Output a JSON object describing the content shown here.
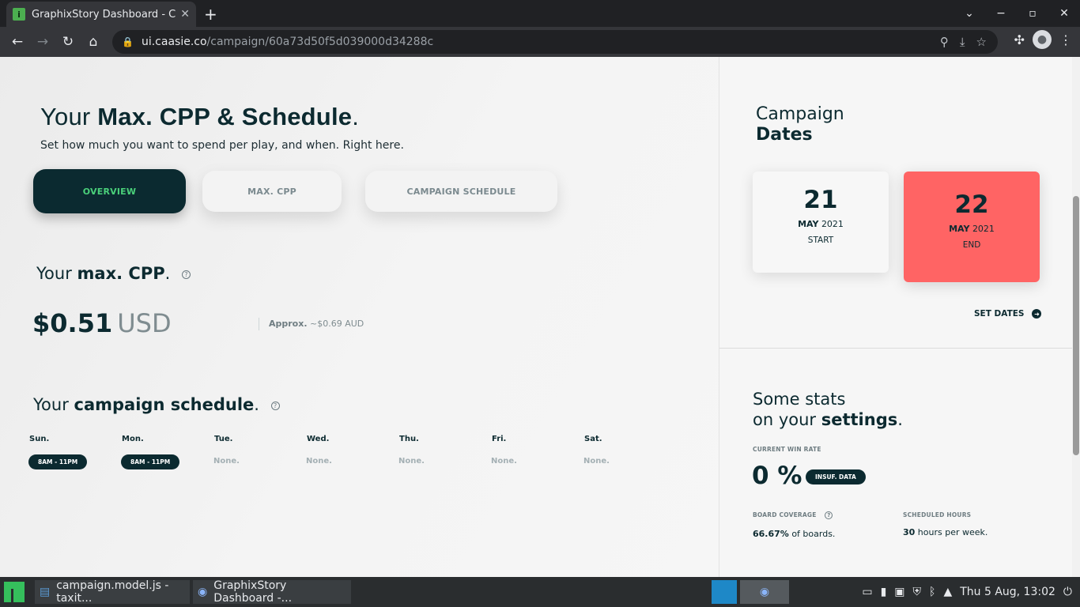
{
  "browser": {
    "tab_title": "GraphixStory Dashboard - CA",
    "url_host": "ui.caasie.co",
    "url_path": "/campaign/60a73d50f5d039000d34288c"
  },
  "header": {
    "title_prefix": "Your ",
    "title_bold": "Max. CPP & Schedule",
    "title_suffix": ".",
    "subtitle": "Set how much you want to spend per play, and when. Right here."
  },
  "tabs": {
    "overview": "OVERVIEW",
    "max_cpp": "MAX. CPP",
    "campaign_schedule": "CAMPAIGN SCHEDULE"
  },
  "cpp": {
    "heading_prefix": "Your ",
    "heading_bold": "max. CPP",
    "heading_suffix": ".",
    "amount": "$0.51",
    "currency": "USD",
    "approx_label": "Approx.",
    "approx_value": "~$0.69 AUD"
  },
  "schedule": {
    "heading_prefix": "Your ",
    "heading_bold": "campaign schedule",
    "heading_suffix": ".",
    "days": [
      {
        "name": "Sun.",
        "value": "8AM - 11PM"
      },
      {
        "name": "Mon.",
        "value": "8AM - 11PM"
      },
      {
        "name": "Tue.",
        "value": "None."
      },
      {
        "name": "Wed.",
        "value": "None."
      },
      {
        "name": "Thu.",
        "value": "None."
      },
      {
        "name": "Fri.",
        "value": "None."
      },
      {
        "name": "Sat.",
        "value": "None."
      }
    ]
  },
  "dates": {
    "title_line1": "Campaign",
    "title_line2": "Dates",
    "start": {
      "day": "21",
      "month": "MAY",
      "year": "2021",
      "label": "START"
    },
    "end": {
      "day": "22",
      "month": "MAY",
      "year": "2021",
      "label": "END"
    },
    "set_dates": "SET DATES"
  },
  "stats": {
    "title_line1": "Some stats",
    "title_line2_prefix": "on your ",
    "title_line2_bold": "settings",
    "title_line2_suffix": ".",
    "win_rate_label": "CURRENT WIN RATE",
    "win_rate": "0 %",
    "win_rate_badge": "INSUF. DATA",
    "coverage_label": "BOARD COVERAGE",
    "coverage_value": "66.67%",
    "coverage_suffix": " of boards.",
    "hours_label": "SCHEDULED HOURS",
    "hours_value": "30",
    "hours_suffix": " hours per week."
  },
  "taskbar": {
    "item1": "campaign.model.js - taxit...",
    "item2": "GraphixStory Dashboard -...",
    "clock": "Thu 5 Aug, 13:02"
  },
  "colors": {
    "primary": "#0b2a30",
    "accent_green": "#4ad07a",
    "end_card": "#ff6464"
  }
}
